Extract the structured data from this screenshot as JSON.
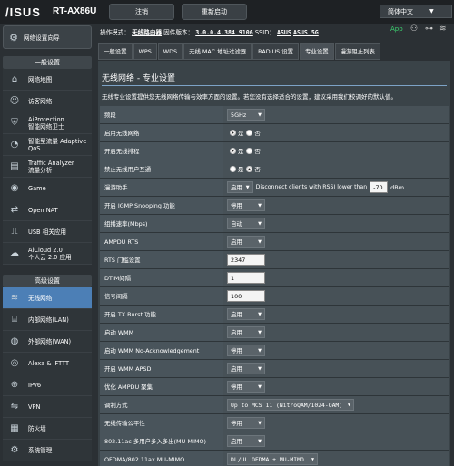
{
  "header": {
    "logo": "/ISUS",
    "model": "RT-AX86U",
    "logout": "注销",
    "reboot": "重新启动",
    "language": "简体中文"
  },
  "info": {
    "mode_label": "操作模式：",
    "mode_value": "无线路由器",
    "fw_label": "固件版本：",
    "fw_value": "3.0.0.4.384_9106",
    "ssid_label": "SSID：",
    "ssid1": "ASUS",
    "ssid2": "ASUS_5G",
    "app": "App"
  },
  "sidebar": {
    "quick": "网络设置向导",
    "general_header": "一般设置",
    "general": [
      {
        "label": "网络地图",
        "icon": "network-map"
      },
      {
        "label": "访客网络",
        "icon": "guest-network"
      },
      {
        "label": "AiProtection\n智能网络卫士",
        "icon": "aiprotection"
      },
      {
        "label": "智能型流量 Adaptive\nQoS",
        "icon": "qos"
      },
      {
        "label": "Traffic Analyzer\n流量分析",
        "icon": "traffic-analyzer"
      },
      {
        "label": "Game",
        "icon": "game"
      },
      {
        "label": "Open NAT",
        "icon": "open-nat"
      },
      {
        "label": "USB 相关应用",
        "icon": "usb"
      },
      {
        "label": "AiCloud 2.0\n个人云 2.0 应用",
        "icon": "aicloud"
      }
    ],
    "advanced_header": "高级设置",
    "advanced": [
      {
        "label": "无线网络",
        "icon": "wireless"
      },
      {
        "label": "内部网络(LAN)",
        "icon": "lan"
      },
      {
        "label": "外部网络(WAN)",
        "icon": "wan"
      },
      {
        "label": "Alexa & IFTTT",
        "icon": "alexa"
      },
      {
        "label": "IPv6",
        "icon": "ipv6"
      },
      {
        "label": "VPN",
        "icon": "vpn"
      },
      {
        "label": "防火墙",
        "icon": "firewall"
      },
      {
        "label": "系统管理",
        "icon": "admin"
      }
    ]
  },
  "tabs": [
    "一般设置",
    "WPS",
    "WDS",
    "无线 MAC 地址过滤器",
    "RADIUS 设置",
    "专业设置",
    "漫游阻止列表"
  ],
  "panel": {
    "title": "无线网络 - 专业设置",
    "desc": "无线专业设置提供您无线网络传输与效率方面的设置。若您没有选择适合的设置，建议采用我们校调好的默认值。",
    "rows": [
      {
        "label": "频段",
        "type": "select",
        "value": "5GHz"
      },
      {
        "label": "启用无线网络",
        "type": "radio",
        "yes": "是",
        "no": "否",
        "on": "yes"
      },
      {
        "label": "开启无线排程",
        "type": "radio",
        "yes": "是",
        "no": "否",
        "on": "yes"
      },
      {
        "label": "禁止无线用户互通",
        "type": "radio",
        "yes": "是",
        "no": "否",
        "on": "no"
      },
      {
        "label": "漫游助手",
        "type": "roam",
        "value": "启用",
        "text1": "Disconnect clients with RSSI lower than",
        "rssi": "-70",
        "unit": "dBm"
      },
      {
        "label": "开启 IGMP Snooping 功能",
        "type": "select",
        "value": "停用"
      },
      {
        "label": "组播速率(Mbps)",
        "type": "select",
        "value": "自动"
      },
      {
        "label": "AMPDU RTS",
        "type": "select",
        "value": "启用"
      },
      {
        "label": "RTS 门槛设置",
        "type": "input",
        "value": "2347"
      },
      {
        "label": "DTIM间隔",
        "type": "input",
        "value": "1"
      },
      {
        "label": "信号间隔",
        "type": "input",
        "value": "100"
      },
      {
        "label": "开启 TX Burst 功能",
        "type": "select",
        "value": "启用"
      },
      {
        "label": "启动 WMM",
        "type": "select",
        "value": "启用"
      },
      {
        "label": "启动 WMM No-Acknowledgement",
        "type": "select",
        "value": "停用"
      },
      {
        "label": "开启 WMM APSD",
        "type": "select",
        "value": "启用"
      },
      {
        "label": "优化 AMPDU 聚集",
        "type": "select",
        "value": "停用"
      },
      {
        "label": "调制方式",
        "type": "select",
        "value": "Up to MCS 11 (NitroQAM/1024-QAM)",
        "mono": true
      },
      {
        "label": "无线传输公平性",
        "type": "select",
        "value": "停用"
      },
      {
        "label": "802.11ac 多用户多入多出(MU-MIMO)",
        "type": "select",
        "value": "启用"
      },
      {
        "label": "OFDMA/802.11ax MU-MIMO",
        "type": "select",
        "value": "DL/UL OFDMA + MU-MIMO",
        "mono": true
      }
    ]
  }
}
